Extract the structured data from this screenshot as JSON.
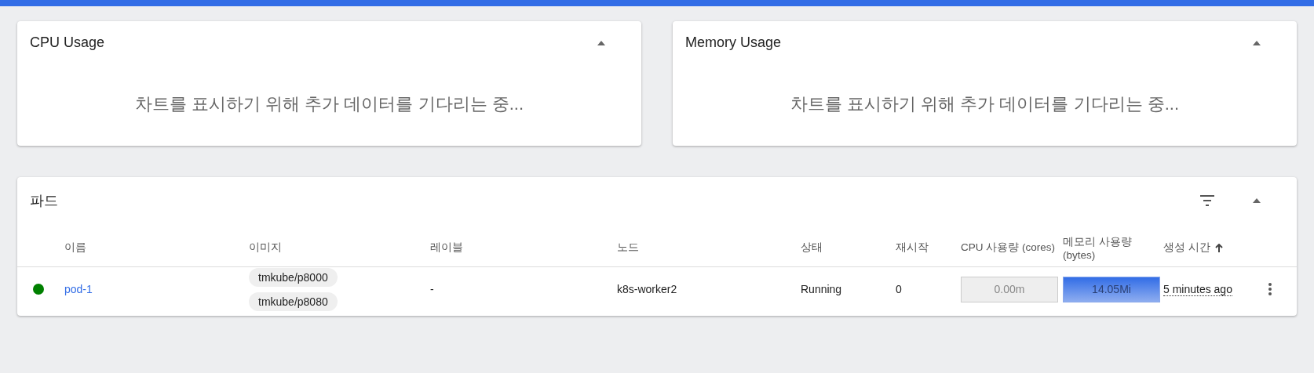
{
  "charts": [
    {
      "title": "CPU Usage",
      "expanded": true,
      "message": "차트를 표시하기 위해 추가 데이터를 기다리는 중..."
    },
    {
      "title": "Memory Usage",
      "expanded": true,
      "message": "차트를 표시하기 위해 추가 데이터를 기다리는 중..."
    }
  ],
  "pods": {
    "title": "파드",
    "expanded": true,
    "columns": [
      {
        "label": "이름",
        "sorted": false
      },
      {
        "label": "이미지",
        "sorted": false
      },
      {
        "label": "레이블",
        "sorted": false
      },
      {
        "label": "노드",
        "sorted": false
      },
      {
        "label": "상태",
        "sorted": false
      },
      {
        "label": "재시작",
        "sorted": false
      },
      {
        "label": "CPU 사용량 (cores)",
        "sorted": false
      },
      {
        "label": "메모리 사용량 (bytes)",
        "sorted": false
      },
      {
        "label": "생성 시간",
        "sorted": true
      }
    ],
    "rows": [
      {
        "color": "#008000",
        "name": "pod-1",
        "images": [
          "tmkube/p8000",
          "tmkube/p8080"
        ],
        "labels": "-",
        "node": "k8s-worker2",
        "status": "Running",
        "restarts": "0",
        "cpu": {
          "reading": "0.00m",
          "level": 0
        },
        "memory": {
          "reading": "14.05Mi",
          "level": 1
        },
        "created": "5 minutes ago"
      }
    ]
  }
}
